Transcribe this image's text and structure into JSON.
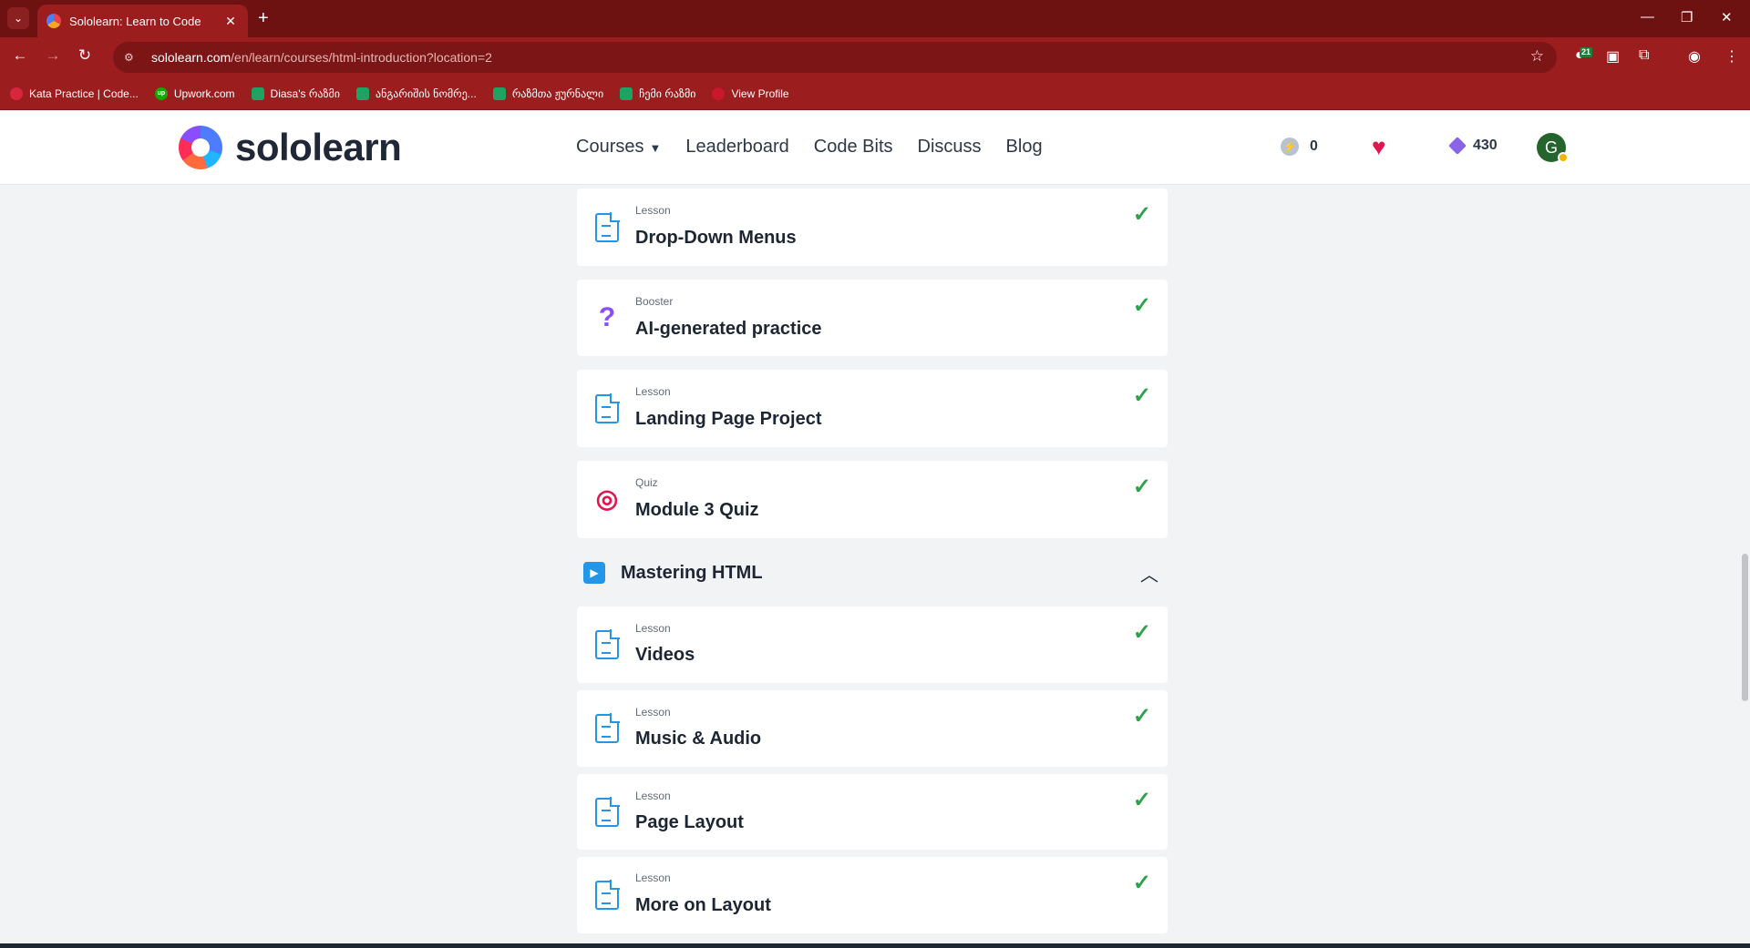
{
  "browser": {
    "tab_title": "Sololearn: Learn to Code",
    "url_host": "sololearn.com",
    "url_path": "/en/learn/courses/html-introduction?location=2",
    "extension_badge": "21",
    "bookmarks": [
      "Kata Practice | Code...",
      "Upwork.com",
      "Diasa's რაზმი",
      "ანგარიშის ნომრე...",
      "რაზმთა ჟურნალი",
      "ჩემი რაზმი",
      "View Profile"
    ]
  },
  "header": {
    "logo_text": "sololearn",
    "nav": [
      "Courses",
      "Leaderboard",
      "Code Bits",
      "Discuss",
      "Blog"
    ],
    "streak": "0",
    "bits": "430",
    "avatar_letter": "G"
  },
  "content": {
    "items_top": [
      {
        "type": "Lesson",
        "title": "Drop-Down Menus",
        "icon": "document-icon"
      },
      {
        "type": "Booster",
        "title": "AI-generated practice",
        "icon": "question-icon"
      },
      {
        "type": "Lesson",
        "title": "Landing Page Project",
        "icon": "document-icon"
      },
      {
        "type": "Quiz",
        "title": "Module 3 Quiz",
        "icon": "target-icon"
      }
    ],
    "module": {
      "title": "Mastering HTML"
    },
    "items_module": [
      {
        "type": "Lesson",
        "title": "Videos",
        "icon": "document-icon"
      },
      {
        "type": "Lesson",
        "title": "Music & Audio",
        "icon": "document-icon"
      },
      {
        "type": "Lesson",
        "title": "Page Layout",
        "icon": "document-icon"
      },
      {
        "type": "Lesson",
        "title": "More on Layout",
        "icon": "document-icon"
      }
    ]
  },
  "colors": {
    "browser_frame": "#9c1d1d",
    "accent_blue": "#2396e8",
    "check_green": "#2fa04b",
    "heart_pink": "#e2164c",
    "bits_purple": "#8a63e8"
  }
}
